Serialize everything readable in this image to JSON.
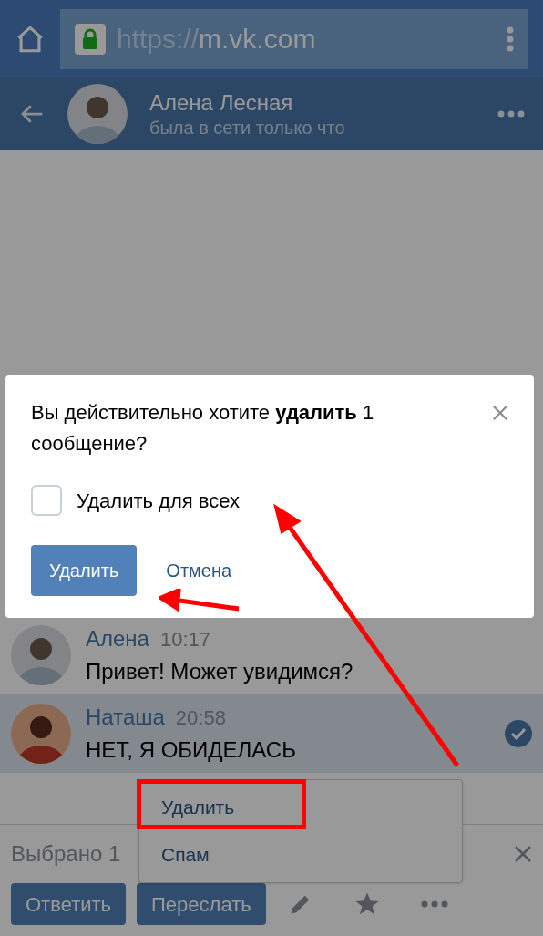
{
  "browser": {
    "url_scheme": "https://",
    "url_host": "m.vk.com"
  },
  "header": {
    "name": "Алена Лесная",
    "status": "была в сети только что"
  },
  "messages": [
    {
      "author": "Алена",
      "time": "10:17",
      "text": "Привет! Может увидимся?",
      "selected": false
    },
    {
      "author": "Наташа",
      "time": "20:58",
      "text": "НЕТ, Я ОБИДЕЛАСЬ",
      "selected": true
    }
  ],
  "selection_bar": {
    "label": "Выбрано 1",
    "buttons": [
      "Ответить",
      "Переслать"
    ]
  },
  "menu": {
    "items": [
      "Удалить",
      "Спам"
    ]
  },
  "dialog": {
    "message": "Вы действительно хотите **удалить** 1 сообщение?",
    "checkbox": {
      "label": "Удалить для всех",
      "checked": false
    },
    "confirm": "Удалить",
    "cancel": "Отмена"
  }
}
